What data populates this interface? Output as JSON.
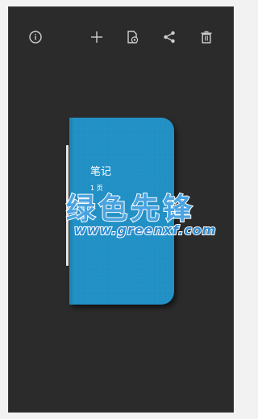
{
  "toolbar": {
    "icons": [
      "info-icon",
      "add-icon",
      "settings-page-icon",
      "share-icon",
      "delete-icon"
    ]
  },
  "notebook": {
    "title": "笔记",
    "pages": "1 页",
    "cover_color": "#1f8fc4"
  },
  "watermark": {
    "name": "绿色先锋",
    "url": "www.greenxf.com"
  },
  "colors": {
    "background": "#2b2b2b",
    "icon": "#d0d0d0"
  }
}
